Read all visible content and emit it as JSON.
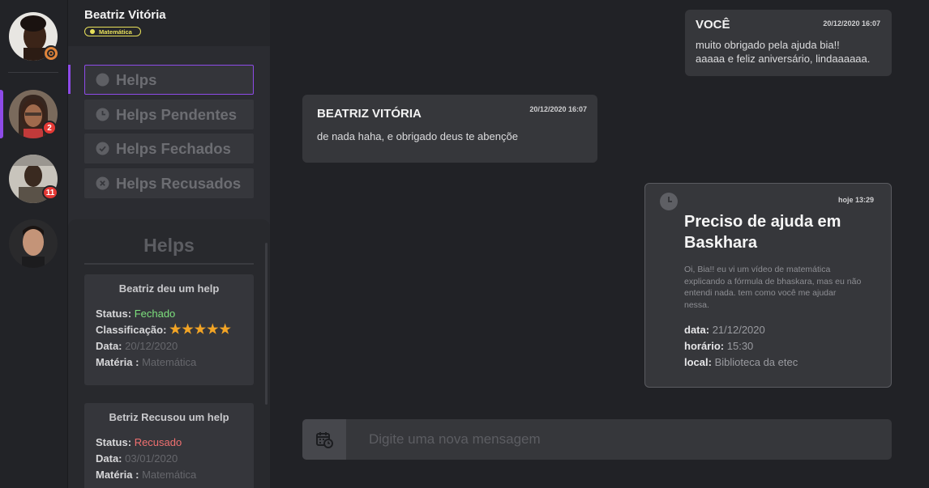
{
  "contact": {
    "name": "Beatriz Vitória",
    "subject_tag": "Matemática"
  },
  "rail": {
    "avatars": [
      {
        "name": "my-profile",
        "badge": ""
      },
      {
        "name": "contact-1",
        "badge": "2"
      },
      {
        "name": "contact-2",
        "badge": "11"
      },
      {
        "name": "contact-3",
        "badge": ""
      }
    ],
    "colors": {
      "active_accent": "#8e4be8",
      "badge": "#e53935",
      "settings": "#e0843a"
    }
  },
  "menu": [
    {
      "label": "Helps",
      "icon": "circle-icon",
      "active": true
    },
    {
      "label": "Helps Pendentes",
      "icon": "clock-icon",
      "active": false
    },
    {
      "label": "Helps Fechados",
      "icon": "check-circle-icon",
      "active": false
    },
    {
      "label": "Helps Recusados",
      "icon": "x-circle-icon",
      "active": false
    }
  ],
  "helps_panel": {
    "title": "Helps",
    "cards": [
      {
        "title": "Beatriz deu um help",
        "status_label": "Status:",
        "status_value": "Fechado",
        "rating_label": "Classificação:",
        "rating": 5,
        "date_label": "Data:",
        "date_value": "20/12/2020",
        "subject_label": "Matéria :",
        "subject_value": "Matemática"
      },
      {
        "title": "Betriz Recusou um help",
        "status_label": "Status:",
        "status_value": "Recusado",
        "date_label": "Data:",
        "date_value": "03/01/2020",
        "subject_label": "Matéria :",
        "subject_value": "Matemática"
      }
    ]
  },
  "messages": [
    {
      "author": "VOCÊ",
      "time": "20/12/2020 16:07",
      "lines": [
        "muito obrigado pela ajuda bia!!",
        "aaaaa e feliz aniversário, lindaaaaaa."
      ]
    },
    {
      "author": "BEATRIZ VITÓRIA",
      "time": "20/12/2020 16:07",
      "lines": [
        "de nada haha, e obrigado deus te abençõe"
      ]
    }
  ],
  "help_request": {
    "time": "hoje 13:29",
    "title": "Preciso de ajuda em Baskhara",
    "description": "Oi, Bia!! eu vi um vídeo de matemática explicando a fórmula de bhaskara, mas eu não entendi nada. tem como você me ajudar nessa.",
    "date_label": "data:",
    "date_value": "21/12/2020",
    "time_label": "horário:",
    "time_value": "15:30",
    "place_label": "local:",
    "place_value": "Biblioteca da etec"
  },
  "composer": {
    "placeholder": "Digite uma nova mensagem",
    "icon": "calendar-clock-icon"
  }
}
